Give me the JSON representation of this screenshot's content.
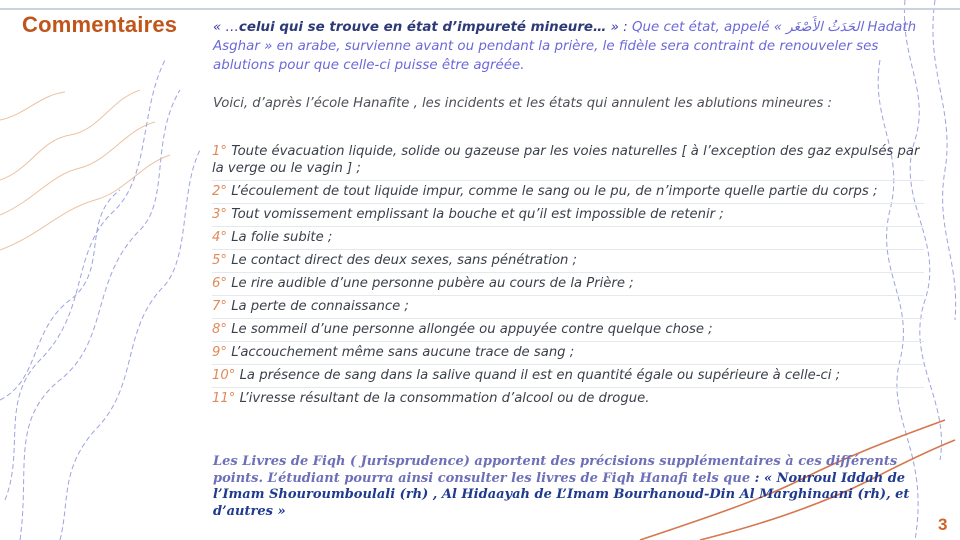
{
  "slide": {
    "title": "Commentaires",
    "page_number": "3"
  },
  "intro": {
    "open_quote": "« …",
    "quoted_bold": "celui qui se trouve en état d’impureté mineure…",
    "close_quote": " » : ",
    "text": "Que cet état, appelé « الحَدَثُ الأَصْغَر Hadath Asghar » en arabe, survienne avant ou pendant la prière, le fidèle sera contraint de renouveler ses ablutions pour que celle-ci puisse être agréée."
  },
  "lead": "Voici, d’après l’école Hanafite , les incidents et les états qui annulent les ablutions mineures :",
  "items": [
    {
      "num": "1°",
      "text": "Toute évacuation liquide, solide ou gazeuse par les voies naturelles [ à l’exception des gaz expulsés par la verge ou le vagin ] ;"
    },
    {
      "num": "2°",
      "text": "L’écoulement de tout liquide impur, comme le sang ou le pu, de n’importe quelle partie du corps ;"
    },
    {
      "num": "3°",
      "text": "Tout vomissement emplissant la bouche et qu’il est impossible de retenir ;"
    },
    {
      "num": "4°",
      "text": "La folie subite ;"
    },
    {
      "num": "5°",
      "text": "Le contact direct des deux sexes, sans pénétration ;"
    },
    {
      "num": "6°",
      "text": "Le rire audible d’une personne pubère au cours de la Prière ;"
    },
    {
      "num": "7°",
      "text": "La perte de connaissance ;"
    },
    {
      "num": "8°",
      "text": "Le sommeil d’une personne allongée ou appuyée contre quelque chose ;"
    },
    {
      "num": "9°",
      "text": "L’accouchement même sans aucune trace de sang ;"
    },
    {
      "num": "10°",
      "text": "La présence de sang dans la salive quand il est en quantité égale ou supérieure à celle-ci ;"
    },
    {
      "num": "11°",
      "text": "L’ivresse résultant de la consommation d’alcool ou de drogue."
    }
  ],
  "closing": {
    "text": "Les Livres de Fiqh ( Jurisprudence) apportent des précisions supplémentaires à ces différents points. L’étudiant pourra ainsi consulter les livres de Fiqh Hanafi tels que ",
    "references": ": « Nouroul Iddah de l’Imam Shouroumboulali (rh) , Al Hidaayah de L’Imam Bourhanoud-Din Al Marghinaani (rh), et d’autres »"
  },
  "colors": {
    "title": "#c0551c",
    "intro": "#6b68d8",
    "numbers": "#e08a5c",
    "references": "#1f3a8f",
    "decoration": "#7f86d6"
  }
}
